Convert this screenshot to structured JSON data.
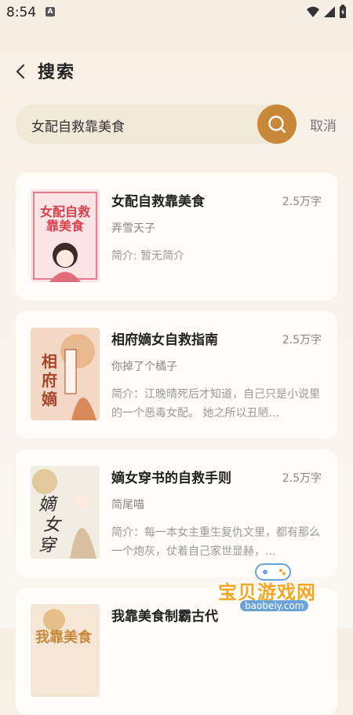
{
  "status_bar": {
    "time": "8:54",
    "notification": "A"
  },
  "header": {
    "title": "搜索"
  },
  "search": {
    "query": "女配自救靠美食",
    "cancel_label": "取消"
  },
  "results": [
    {
      "title": "女配自救靠美食",
      "word_count": "2.5万字",
      "author": "弄雪天子",
      "intro": "简介: 暂无简介",
      "cover_text": "女配自救靠美食",
      "cover_colors": [
        "#fbe4e6",
        "#d9414f"
      ]
    },
    {
      "title": "相府嫡女自救指南",
      "word_count": "2.5万字",
      "author": "你掉了个橘子",
      "intro": "简介：江晚晴死后才知道，自己只是小说里的一个恶毒女配。 她之所以丑陋...",
      "cover_text": "相府嫡女自救指南",
      "cover_colors": [
        "#f3d9c5",
        "#a8452c"
      ]
    },
    {
      "title": "嫡女穿书的自救手则",
      "word_count": "2.5万字",
      "author": "简尾喵",
      "intro": "简介：每一本女主重生复仇文里，都有那么一个炮灰，仗着自己家世显赫，...",
      "cover_text": "嫡女穿书",
      "cover_colors": [
        "#f2ede3",
        "#2a2a2a"
      ]
    },
    {
      "title": "我靠美食制霸古代",
      "word_count": "",
      "author": "",
      "intro": "",
      "cover_text": "",
      "cover_colors": [
        "#f6e6d6",
        "#c8883a"
      ]
    }
  ],
  "watermark": {
    "text": "宝贝游戏网",
    "url": "baobeiy.com"
  },
  "colors": {
    "accent": "#c8883a",
    "search_bg": "#f1e8d8",
    "card_bg": "#fffdf9"
  }
}
